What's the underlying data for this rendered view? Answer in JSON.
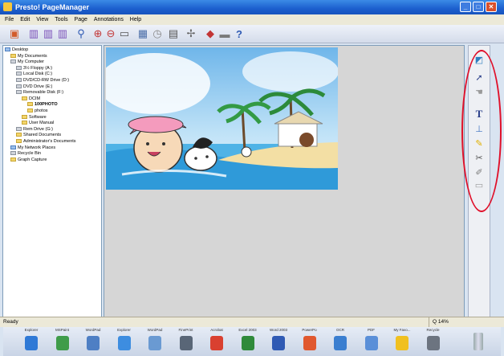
{
  "window": {
    "title": "Presto! PageManager"
  },
  "menu": [
    "File",
    "Edit",
    "View",
    "Tools",
    "Page",
    "Annotations",
    "Help"
  ],
  "toolbar_icons": [
    "open-icon",
    "scan-icon",
    "scan-icon",
    "zoom-icon",
    "zoom-in-icon",
    "zoom-out-icon",
    "fit-icon",
    "layout-icon",
    "clock-icon",
    "tools-icon",
    "send-icon",
    "print-icon",
    "help-icon"
  ],
  "tree": [
    {
      "label": "Desktop",
      "indent": 0,
      "icon": "blue"
    },
    {
      "label": "My Documents",
      "indent": 1,
      "icon": "folder"
    },
    {
      "label": "My Computer",
      "indent": 1,
      "icon": "gray"
    },
    {
      "label": "3½ Floppy (A:)",
      "indent": 2,
      "icon": "gray"
    },
    {
      "label": "Local Disk (C:)",
      "indent": 2,
      "icon": "gray"
    },
    {
      "label": "DVD/CD-RW Drive (D:)",
      "indent": 2,
      "icon": "gray"
    },
    {
      "label": "DVD Drive (E:)",
      "indent": 2,
      "icon": "gray"
    },
    {
      "label": "Removable Disk (F:)",
      "indent": 2,
      "icon": "gray"
    },
    {
      "label": "DCIM",
      "indent": 3,
      "icon": "folder"
    },
    {
      "label": "100PHOTO",
      "indent": 4,
      "icon": "folder",
      "selected": true
    },
    {
      "label": "photos",
      "indent": 4,
      "icon": "folder"
    },
    {
      "label": "Software",
      "indent": 3,
      "icon": "folder"
    },
    {
      "label": "User Manual",
      "indent": 3,
      "icon": "folder"
    },
    {
      "label": "Rem Drive (G:)",
      "indent": 2,
      "icon": "gray"
    },
    {
      "label": "Shared Documents",
      "indent": 2,
      "icon": "folder"
    },
    {
      "label": "Administrator's Documents",
      "indent": 2,
      "icon": "folder"
    },
    {
      "label": "My Network Places",
      "indent": 1,
      "icon": "blue"
    },
    {
      "label": "Recycle Bin",
      "indent": 1,
      "icon": "gray"
    },
    {
      "label": "Graph Capture",
      "indent": 1,
      "icon": "folder"
    }
  ],
  "status": {
    "text": "Ready",
    "zoom": "Q 14%"
  },
  "dock_apps": [
    {
      "label": "Explorer",
      "color": "#2f79d6"
    },
    {
      "label": "MSPaint",
      "color": "#3f9c4a"
    },
    {
      "label": "WordPad",
      "color": "#4e7fc4"
    },
    {
      "label": "Explorer",
      "color": "#3d8de0"
    },
    {
      "label": "WordPad",
      "color": "#6a9ad2"
    },
    {
      "label": "FinePrint",
      "color": "#596677"
    },
    {
      "label": "Acrobat",
      "color": "#d94030"
    },
    {
      "label": "Excel 2003",
      "color": "#2f8a3b"
    },
    {
      "label": "Word 2003",
      "color": "#2f5ab4"
    },
    {
      "label": "PowerPo",
      "color": "#e0582f"
    },
    {
      "label": "OCR",
      "color": "#3a7ed0"
    },
    {
      "label": "PDF",
      "color": "#5a8fd8"
    },
    {
      "label": "My Favo...",
      "color": "#f0c020"
    },
    {
      "label": "Recycle",
      "color": "#6c7480"
    }
  ],
  "right_tools": [
    "annotation-icon",
    "pointer-icon",
    "hand-icon",
    "text-icon",
    "stamp-icon",
    "highlighter-icon",
    "scissors-icon",
    "pen-icon",
    "eraser-icon"
  ],
  "accent": {
    "title_blue": "#1c5fce",
    "highlight_red": "#e0102a"
  }
}
